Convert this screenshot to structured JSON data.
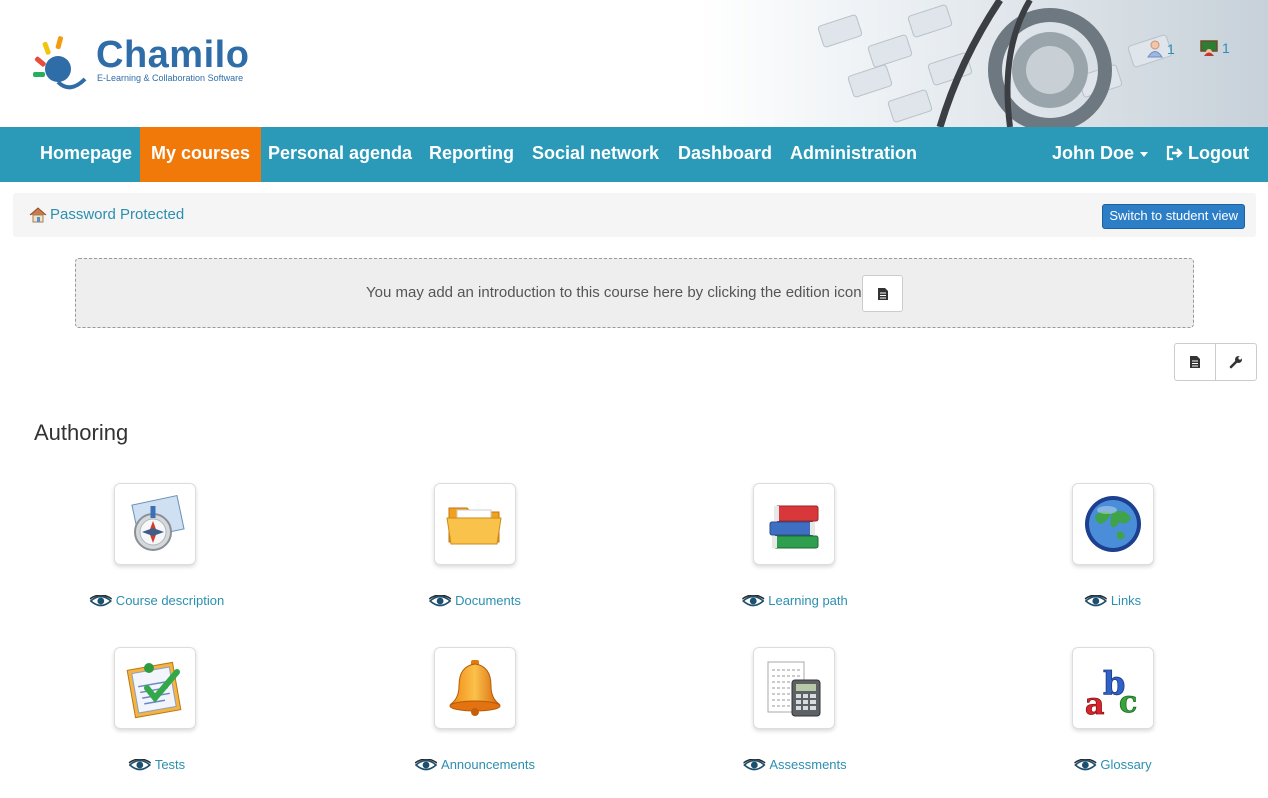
{
  "brand": {
    "name": "Chamilo",
    "tagline": "E-Learning & Collaboration Software"
  },
  "header": {
    "users_count": "1",
    "sessions_count": "1"
  },
  "nav": {
    "items": [
      "Homepage",
      "My courses",
      "Personal agenda",
      "Reporting",
      "Social network",
      "Dashboard",
      "Administration"
    ],
    "active": "My courses",
    "user": "John Doe",
    "logout": "Logout"
  },
  "breadcrumb": {
    "course": "Password Protected"
  },
  "switch_view": "Switch to student view",
  "intro": {
    "text": "You may add an introduction to this course here by clicking the edition icon"
  },
  "section": {
    "title": "Authoring"
  },
  "tools": [
    {
      "label": "Course description",
      "icon": "compass-icon"
    },
    {
      "label": "Documents",
      "icon": "folder-icon"
    },
    {
      "label": "Learning path",
      "icon": "books-icon"
    },
    {
      "label": "Links",
      "icon": "globe-icon"
    },
    {
      "label": "Tests",
      "icon": "checklist-icon"
    },
    {
      "label": "Announcements",
      "icon": "bell-icon"
    },
    {
      "label": "Assessments",
      "icon": "calculator-icon"
    },
    {
      "label": "Glossary",
      "icon": "abc-icon"
    }
  ],
  "colors": {
    "navbar": "#2b9ab8",
    "active_nav": "#f0790a",
    "link": "#2b8faf",
    "brand": "#2f6da8"
  }
}
